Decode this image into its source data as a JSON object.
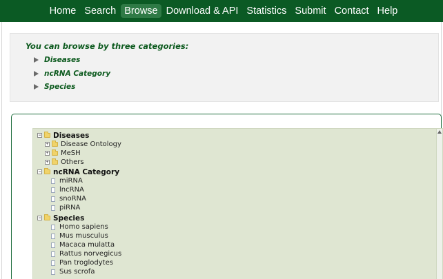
{
  "nav": {
    "items": [
      {
        "label": "Home"
      },
      {
        "label": "Search"
      },
      {
        "label": "Browse"
      },
      {
        "label": "Download & API"
      },
      {
        "label": "Statistics"
      },
      {
        "label": "Submit"
      },
      {
        "label": "Contact"
      },
      {
        "label": "Help"
      }
    ],
    "active_index": 2
  },
  "intro": {
    "title": "You can browse by three categories:",
    "links": [
      {
        "label": "Diseases"
      },
      {
        "label": "ncRNA Category"
      },
      {
        "label": "Species"
      }
    ]
  },
  "tree": {
    "diseases": {
      "label": "Diseases",
      "children": [
        {
          "label": "Disease Ontology"
        },
        {
          "label": "MeSH"
        },
        {
          "label": "Others"
        }
      ]
    },
    "ncrna": {
      "label": "ncRNA Category",
      "children": [
        {
          "label": "miRNA"
        },
        {
          "label": "lncRNA"
        },
        {
          "label": "snoRNA"
        },
        {
          "label": "piRNA"
        }
      ]
    },
    "species": {
      "label": "Species",
      "children": [
        {
          "label": "Homo sapiens"
        },
        {
          "label": "Mus musculus"
        },
        {
          "label": "Macaca mulatta"
        },
        {
          "label": "Rattus norvegicus"
        },
        {
          "label": "Pan troglodytes"
        },
        {
          "label": "Sus scrofa"
        }
      ]
    },
    "toggle_minus": "−",
    "toggle_plus": "+"
  },
  "colors": {
    "navbar": "#0b5a24",
    "nav_active": "#2f7a46",
    "link_text": "#0c5a1e",
    "tree_bg": "#dfe6d2",
    "panel_border": "#1b6b3a"
  }
}
